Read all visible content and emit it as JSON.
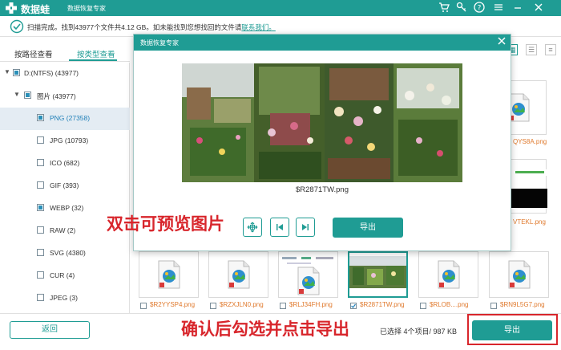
{
  "app": {
    "name": "数据蛙",
    "subtitle": "数据恢复专家"
  },
  "status": {
    "text": "扫描完成。找到43977个文件共4.12 GB。如未能找到您想找回的文件请",
    "link": "联系我们。"
  },
  "tabs": [
    {
      "label": "按路径查看"
    },
    {
      "label": "按类型查看"
    }
  ],
  "tree": [
    {
      "label": "D:(NTFS) (43977)"
    },
    {
      "label": "图片 (43977)"
    },
    {
      "label": "PNG (27358)"
    },
    {
      "label": "JPG (10793)"
    },
    {
      "label": "ICO (682)"
    },
    {
      "label": "GIF (393)"
    },
    {
      "label": "WEBP (32)"
    },
    {
      "label": "RAW (2)"
    },
    {
      "label": "SVG (4380)"
    },
    {
      "label": "CUR (4)"
    },
    {
      "label": "JPEG (3)"
    }
  ],
  "right_files": [
    {
      "name": "QYS8A.png"
    },
    {
      "name": "VTEKL.png"
    },
    {
      "name": ""
    }
  ],
  "thumbnails": [
    {
      "name": "$R2YYSP4.png"
    },
    {
      "name": "$RZXJLN0.png"
    },
    {
      "name": "$RLJ34FH.png"
    },
    {
      "name": "$R2871TW.png"
    },
    {
      "name": "$RLOB....png"
    },
    {
      "name": "$RN9L5G7.png"
    }
  ],
  "dialog": {
    "title": "数据恢复专家",
    "filename": "$R2871TW.png",
    "export_label": "导出",
    "annotation": "双击可预览图片"
  },
  "bottom": {
    "back_label": "返回",
    "selection_info": "已选择 4个项目/ 987 KB",
    "export_label": "导出",
    "annotation": "确认后勾选并点击导出"
  },
  "colors": {
    "accent": "#1f9c94",
    "annotation": "#d8262c",
    "filename": "#e07a2e",
    "selected_row": "#e4ecf3"
  }
}
